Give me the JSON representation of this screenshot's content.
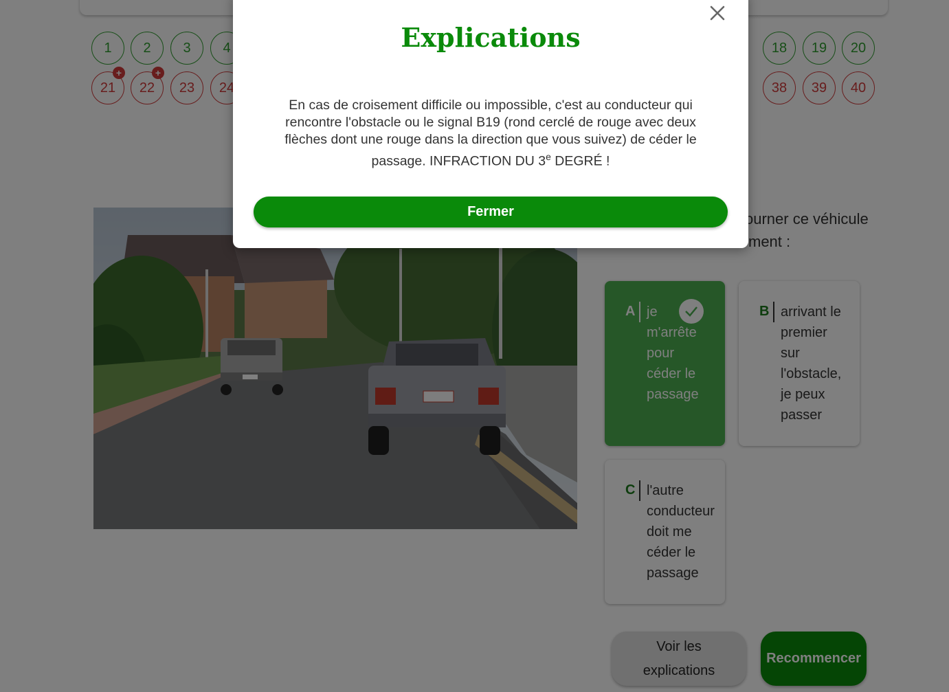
{
  "question_nav": {
    "row1": [
      {
        "n": "1",
        "status": "ok"
      },
      {
        "n": "2",
        "status": "ok"
      },
      {
        "n": "3",
        "status": "ok"
      },
      {
        "n": "4",
        "status": "ok"
      },
      {
        "n": "18",
        "status": "ok"
      },
      {
        "n": "19",
        "status": "ok"
      },
      {
        "n": "20",
        "status": "ok"
      }
    ],
    "row2": [
      {
        "n": "21",
        "status": "bad",
        "plus": "+"
      },
      {
        "n": "22",
        "status": "bad",
        "plus": "+"
      },
      {
        "n": "23",
        "status": "bad"
      },
      {
        "n": "24",
        "status": "bad"
      },
      {
        "n": "38",
        "status": "bad"
      },
      {
        "n": "39",
        "status": "bad"
      },
      {
        "n": "40",
        "status": "bad"
      }
    ]
  },
  "question": {
    "line1": "ourner ce véhicule",
    "line2": "ment :"
  },
  "answers": [
    {
      "letter": "A",
      "lines": [
        "je",
        "m'arrête",
        "pour",
        "céder le",
        "passage"
      ],
      "correct": true
    },
    {
      "letter": "B",
      "lines": [
        "arrivant le",
        "premier",
        "sur",
        "l'obstacle,",
        "je peux",
        "passer"
      ],
      "correct": false
    },
    {
      "letter": "C",
      "lines": [
        "l'autre",
        "conducteur",
        "doit me",
        "céder le",
        "passage"
      ],
      "correct": false
    }
  ],
  "buttons": {
    "voir_line1": "Voir les",
    "voir_line2": "explications",
    "restart": "Recommencer"
  },
  "modal": {
    "title": "Explications",
    "body_main": "En cas de croisement difficile ou impossible, c'est au conducteur qui rencontre l'obstacle ou le signal B19 (rond cerclé de rouge avec deux flèches dont une rouge dans la direction que vous suivez) de céder le passage. INFRACTION DU 3",
    "body_sup": "e",
    "body_end": " DEGRÉ !",
    "close_label": "Fermer"
  },
  "colors": {
    "accent_green": "#0a8a0a",
    "correct_green": "#4caf50",
    "ok_circle": "#2e9c2e",
    "bad_circle": "#d03a3a"
  },
  "icons": [
    "close-icon",
    "check-icon"
  ]
}
